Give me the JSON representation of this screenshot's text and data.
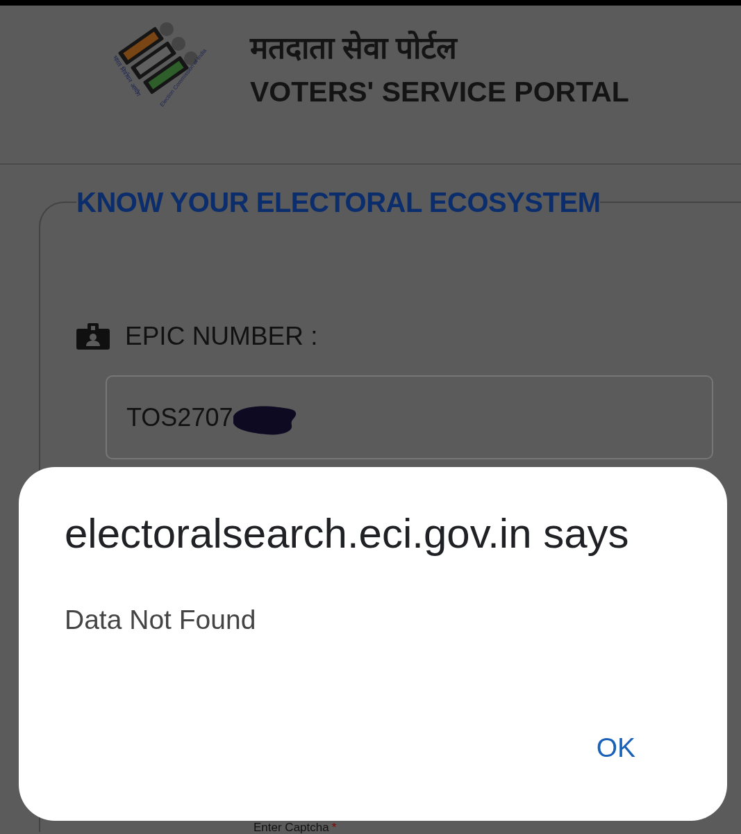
{
  "header": {
    "logo": {
      "hindi_caption": "भारत निर्वाचन आयोग",
      "english_caption": "Election Commission of India"
    },
    "title_hindi": "मतदाता सेवा पोर्टल",
    "title": "VOTERS' SERVICE PORTAL"
  },
  "form": {
    "legend": "KNOW YOUR ELECTORAL ECOSYSTEM",
    "epic_field": {
      "label": "EPIC NUMBER :",
      "value": "TOS2707",
      "redacted": true
    },
    "captcha_label": {
      "text": "Enter Captcha",
      "required_mark": "*"
    }
  },
  "dialog": {
    "title": "electoralsearch.eci.gov.in says",
    "message": "Data Not Found",
    "buttons": [
      "OK"
    ]
  }
}
